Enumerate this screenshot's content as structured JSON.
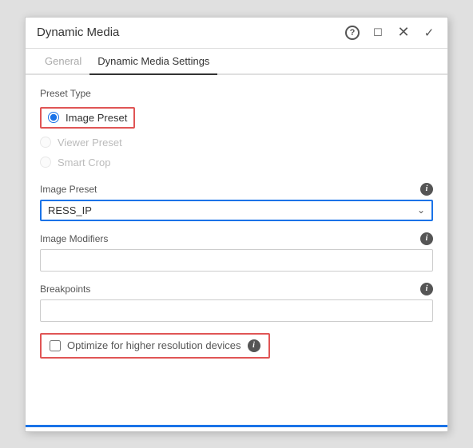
{
  "dialog": {
    "title": "Dynamic Media",
    "close_icon": "×",
    "check_icon": "✓",
    "question_icon": "?",
    "screen_icon": "▭"
  },
  "tabs": {
    "inactive_tab": "General",
    "active_tab": "Dynamic Media Settings"
  },
  "preset_type": {
    "label": "Preset Type",
    "options": [
      {
        "id": "image-preset",
        "label": "Image Preset",
        "checked": true,
        "disabled": false,
        "highlighted": true
      },
      {
        "id": "viewer-preset",
        "label": "Viewer Preset",
        "checked": false,
        "disabled": true,
        "highlighted": false
      },
      {
        "id": "smart-crop",
        "label": "Smart Crop",
        "checked": false,
        "disabled": true,
        "highlighted": false
      }
    ]
  },
  "image_preset_field": {
    "label": "Image Preset",
    "value": "RESS_IP",
    "info": "i"
  },
  "image_modifiers_field": {
    "label": "Image Modifiers",
    "value": "",
    "placeholder": "",
    "info": "i"
  },
  "breakpoints_field": {
    "label": "Breakpoints",
    "value": "",
    "placeholder": "",
    "info": "i"
  },
  "optimize_checkbox": {
    "label": "Optimize for higher resolution devices",
    "checked": false,
    "info": "i"
  }
}
